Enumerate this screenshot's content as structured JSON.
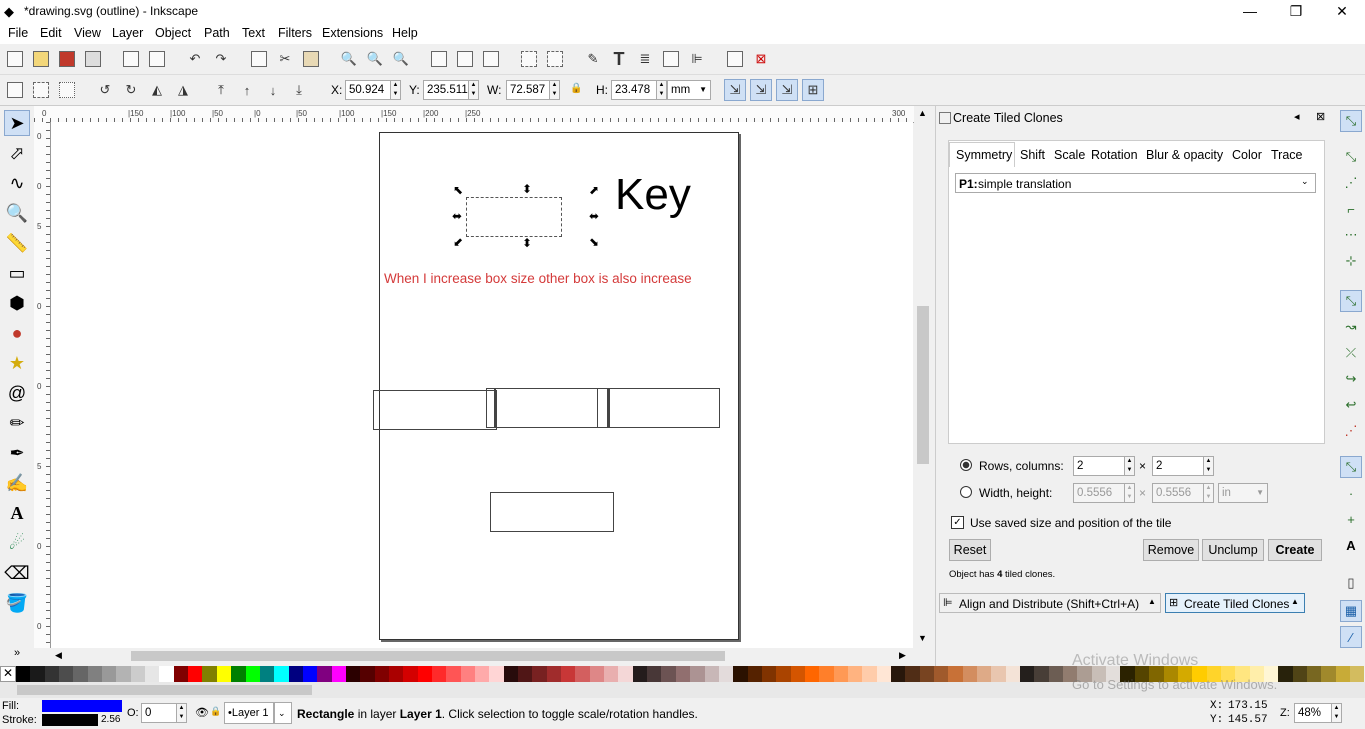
{
  "window": {
    "title": "*drawing.svg (outline) - Inkscape",
    "min": "—",
    "max": "❐",
    "close": "✕"
  },
  "menu": [
    "File",
    "Edit",
    "View",
    "Layer",
    "Object",
    "Path",
    "Text",
    "Filters",
    "Extensions",
    "Help"
  ],
  "controls": {
    "x_label": "X:",
    "x_value": "50.924",
    "y_label": "Y:",
    "y_value": "235.511",
    "w_label": "W:",
    "w_value": "72.587",
    "h_label": "H:",
    "h_value": "23.478",
    "unit": "mm"
  },
  "ruler": {
    "h_ticks": [
      "0",
      "|150",
      "|100",
      "|50",
      "|0",
      "|50",
      "|100",
      "|150",
      "|200",
      "|250",
      "300"
    ],
    "v_ticks": [
      "0",
      "0",
      "5",
      "0",
      "0",
      "5",
      "0",
      "0",
      "5",
      "0",
      "5"
    ]
  },
  "canvas": {
    "key_text": "Key",
    "note": "When I increase box size other box is also increase"
  },
  "dialog": {
    "title": "Create Tiled Clones",
    "tabs": [
      "Symmetry",
      "Shift",
      "Scale",
      "Rotation",
      "Blur & opacity",
      "Color",
      "Trace"
    ],
    "symmetry_prefix": "P1:",
    "symmetry_value": "simple translation",
    "rows_label": "Rows, columns:",
    "rows": "2",
    "times": "×",
    "columns": "2",
    "wh_label": "Width, height:",
    "width": "0.5556",
    "height": "0.5556",
    "wh_unit": "in",
    "use_saved_label": "Use saved size and position of the tile",
    "reset": "Reset",
    "remove": "Remove",
    "unclump": "Unclump",
    "create": "Create",
    "status_prefix": "Object has ",
    "status_count": "4",
    "status_suffix": " tiled clones."
  },
  "docked": {
    "align": "Align and Distribute (Shift+Ctrl+A)",
    "tiled": "Create Tiled Clones"
  },
  "palette": [
    "#000000",
    "#1a1a1a",
    "#333333",
    "#4d4d4d",
    "#666666",
    "#808080",
    "#999999",
    "#b3b3b3",
    "#cccccc",
    "#e6e6e6",
    "#ffffff",
    "#800000",
    "#ff0000",
    "#808000",
    "#ffff00",
    "#008000",
    "#00ff00",
    "#008080",
    "#00ffff",
    "#000080",
    "#0000ff",
    "#800080",
    "#ff00ff",
    "#2b0000",
    "#550000",
    "#800000",
    "#aa0000",
    "#d40000",
    "#ff0000",
    "#ff2a2a",
    "#ff5555",
    "#ff8080",
    "#ffaaaa",
    "#ffd5d5",
    "#280b0b",
    "#501616",
    "#782121",
    "#a02c2c",
    "#c83737",
    "#d35f5f",
    "#de8787",
    "#e9afaf",
    "#f4d7d7",
    "#241c1c",
    "#483737",
    "#6c5353",
    "#916f6f",
    "#ac9393",
    "#c8b7b7",
    "#e3dbdb",
    "#2b1100",
    "#552200",
    "#803300",
    "#aa4400",
    "#d45500",
    "#ff6600",
    "#ff7f2a",
    "#ff9955",
    "#ffb380",
    "#ffccaa",
    "#ffe6d5",
    "#28170b",
    "#502d16",
    "#784421",
    "#a05a2c",
    "#c87137",
    "#d38d5f",
    "#deaa87",
    "#e9c6af",
    "#f4e3d7",
    "#241f1c",
    "#483e37",
    "#6c5d53",
    "#917c6f",
    "#ac9d93",
    "#c8beb7",
    "#e3dedb",
    "#2b2200",
    "#554400",
    "#806600",
    "#aa8800",
    "#d4aa00",
    "#ffcc00",
    "#ffd42a",
    "#ffdd55",
    "#ffe680",
    "#ffeeaa",
    "#fff6d5",
    "#28220b",
    "#504416",
    "#786721",
    "#a0892c",
    "#c8ab37",
    "#d3bc5f"
  ],
  "status": {
    "fill_label": "Fill:",
    "stroke_label": "Stroke:",
    "fill_color": "#0000ff",
    "stroke_color": "#000000",
    "stroke_width": "2.56",
    "opacity_label": "O:",
    "opacity_value": "0",
    "layer": "•Layer 1",
    "message_obj": "Rectangle",
    "message_mid": " in layer ",
    "message_layer": "Layer 1",
    "message_end": ". Click selection to toggle scale/rotation handles.",
    "x_label": "X:",
    "x_value": "173.15",
    "y_label": "Y:",
    "y_value": "145.57",
    "z_label": "Z:",
    "zoom": "48%"
  },
  "watermark": {
    "line1": "Activate Windows",
    "line2": "Go to Settings to activate Windows."
  }
}
